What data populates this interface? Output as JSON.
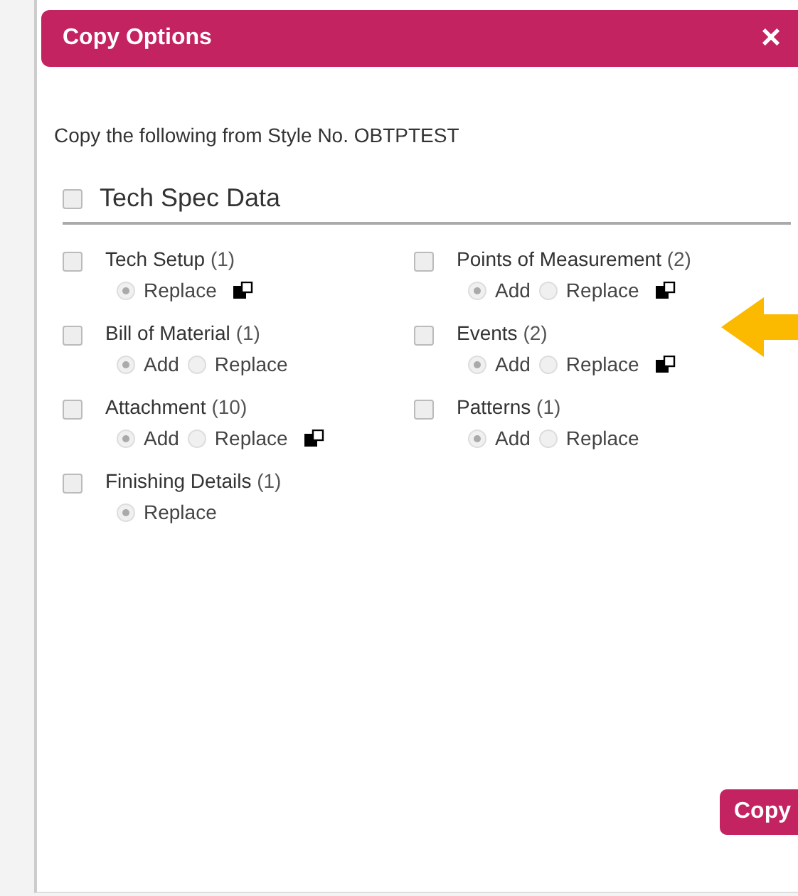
{
  "dialog": {
    "title": "Copy Options",
    "close": "×"
  },
  "intro": "Copy the following from Style No. OBTPTEST",
  "section": {
    "label": "Tech Spec Data",
    "checked": false
  },
  "items": [
    {
      "name": "Tech Setup",
      "count": "(1)",
      "checked": false,
      "options": [
        {
          "label": "Replace",
          "selected": true
        }
      ],
      "copy_icon": true
    },
    {
      "name": "Points of Measurement",
      "count": "(2)",
      "checked": false,
      "options": [
        {
          "label": "Add",
          "selected": true
        },
        {
          "label": "Replace",
          "selected": false
        }
      ],
      "copy_icon": true
    },
    {
      "name": "Bill of Material",
      "count": "(1)",
      "checked": false,
      "options": [
        {
          "label": "Add",
          "selected": true
        },
        {
          "label": "Replace",
          "selected": false
        }
      ],
      "copy_icon": false
    },
    {
      "name": "Events",
      "count": "(2)",
      "checked": false,
      "options": [
        {
          "label": "Add",
          "selected": true
        },
        {
          "label": "Replace",
          "selected": false
        }
      ],
      "copy_icon": true
    },
    {
      "name": "Attachment",
      "count": "(10)",
      "checked": false,
      "options": [
        {
          "label": "Add",
          "selected": true
        },
        {
          "label": "Replace",
          "selected": false
        }
      ],
      "copy_icon": true
    },
    {
      "name": "Patterns",
      "count": "(1)",
      "checked": false,
      "options": [
        {
          "label": "Add",
          "selected": true
        },
        {
          "label": "Replace",
          "selected": false
        }
      ],
      "copy_icon": false
    },
    {
      "name": "Finishing Details",
      "count": "(1)",
      "checked": false,
      "options": [
        {
          "label": "Replace",
          "selected": true
        }
      ],
      "copy_icon": false
    }
  ],
  "copy_button": "Copy"
}
